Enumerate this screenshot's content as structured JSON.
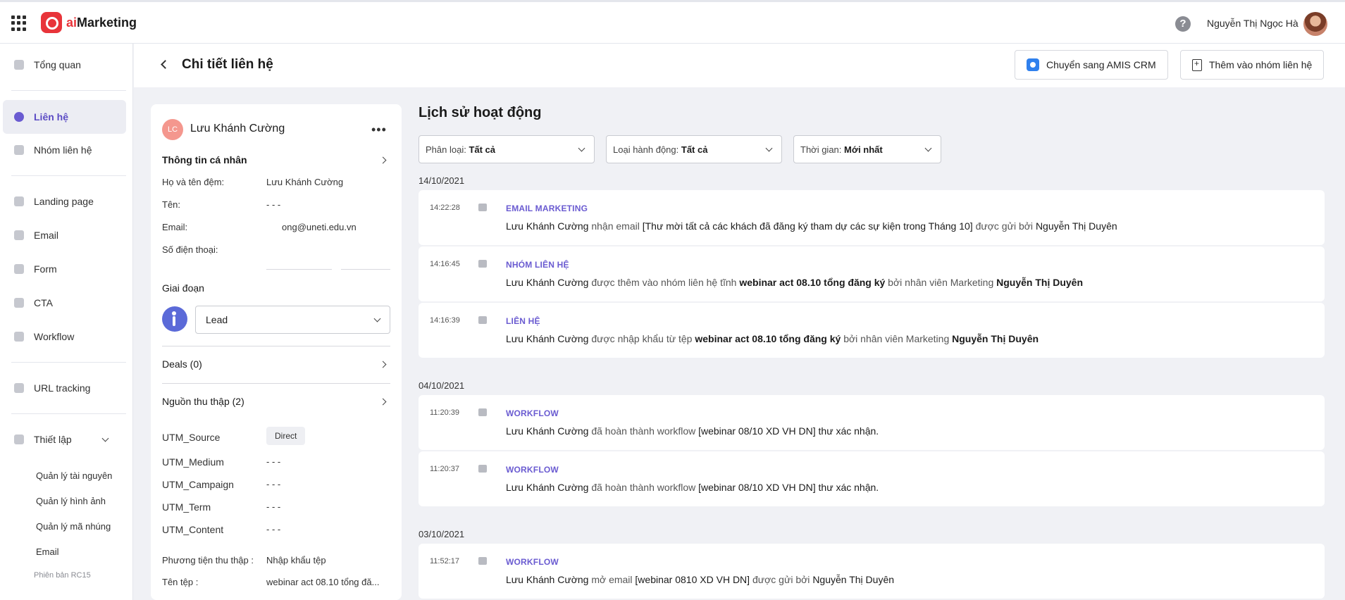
{
  "app": {
    "name_prefix": "ai",
    "name_suffix": "Marketing",
    "help_glyph": "?",
    "user_name": "Nguyễn Thị Ngọc Hà"
  },
  "sidebar": {
    "items": [
      {
        "label": "Tổng quan",
        "icon": "dashboard-icon"
      },
      {
        "label": "Liên hệ",
        "icon": "contacts-icon",
        "active": true
      },
      {
        "label": "Nhóm liên hệ",
        "icon": "contact-group-icon"
      },
      {
        "label": "Landing page",
        "icon": "landing-page-icon"
      },
      {
        "label": "Email",
        "icon": "email-icon"
      },
      {
        "label": "Form",
        "icon": "form-icon"
      },
      {
        "label": "CTA",
        "icon": "cta-icon"
      },
      {
        "label": "Workflow",
        "icon": "workflow-icon"
      },
      {
        "label": "URL tracking",
        "icon": "link-icon"
      },
      {
        "label": "Thiết lập",
        "icon": "gear-icon"
      }
    ],
    "settings_sub": [
      "Quản lý tài nguyên",
      "Quản lý hình ảnh",
      "Quản lý mã nhúng",
      "Email"
    ],
    "version": "Phiên bản RC15"
  },
  "header": {
    "title": "Chi tiết liên hệ",
    "crm_button": "Chuyển sang AMIS CRM",
    "group_button": "Thêm vào nhóm liên hệ"
  },
  "contact": {
    "initials": "LC",
    "name": "Lưu Khánh Cường",
    "more": "•••",
    "personal_title": "Thông tin cá nhân",
    "fields": [
      {
        "label": "Họ và tên đệm:",
        "value": "Lưu Khánh Cường"
      },
      {
        "label": "Tên:",
        "value": "- - -"
      },
      {
        "label": "Email:",
        "value": "ong@uneti.edu.vn"
      },
      {
        "label": "Số điện thoại:",
        "value": ""
      }
    ],
    "stage_title": "Giai đoạn",
    "stage_value": "Lead",
    "deals": "Deals (0)",
    "sources": "Nguồn thu thập (2)",
    "utm": [
      {
        "label": "UTM_Source",
        "value": "Direct"
      },
      {
        "label": "UTM_Medium",
        "value": "- - -"
      },
      {
        "label": "UTM_Campaign",
        "value": "- - -"
      },
      {
        "label": "UTM_Term",
        "value": "- - -"
      },
      {
        "label": "UTM_Content",
        "value": "- - -"
      }
    ],
    "channel_label": "Phương tiện thu thập :",
    "channel_value": "Nhập khẩu tệp",
    "file_label": "Tên tệp :",
    "file_value": "webinar act 08.10 tổng đă..."
  },
  "history": {
    "title": "Lịch sử hoạt động",
    "filters": [
      {
        "label": "Phân loại: ",
        "value": "Tất cả"
      },
      {
        "label": "Loại hành động: ",
        "value": "Tất cả"
      },
      {
        "label": "Thời gian: ",
        "value": "Mới nhất"
      }
    ],
    "groups": [
      {
        "date": "14/10/2021",
        "events": [
          {
            "time": "14:22:28",
            "type": "EMAIL MARKETING",
            "icon": "email-icon",
            "parts": [
              [
                "k",
                "Lưu Khánh Cường"
              ],
              [
                "n",
                " nhận email "
              ],
              [
                "k",
                "[Thư mời tất cả các khách đã đăng ký tham dự các sự kiện trong Tháng 10]"
              ],
              [
                "n",
                " được gửi bởi "
              ],
              [
                "k",
                "Nguyễn Thị Duyên"
              ]
            ]
          },
          {
            "time": "14:16:45",
            "type": "NHÓM LIÊN HỆ",
            "icon": "contact-group-icon",
            "parts": [
              [
                "k",
                "Lưu Khánh Cường"
              ],
              [
                "n",
                " được thêm vào nhóm liên hệ tĩnh "
              ],
              [
                "kb",
                "webinar act 08.10 tổng đăng ký"
              ],
              [
                "n",
                " bởi nhân viên Marketing "
              ],
              [
                "kb",
                "Nguyễn Thị Duyên"
              ]
            ]
          },
          {
            "time": "14:16:39",
            "type": "LIÊN HỆ",
            "icon": "contacts-icon",
            "parts": [
              [
                "k",
                "Lưu Khánh Cường"
              ],
              [
                "n",
                " được nhập khẩu từ tệp "
              ],
              [
                "kb",
                "webinar act 08.10 tổng đăng ký"
              ],
              [
                "n",
                " bởi nhân viên Marketing "
              ],
              [
                "kb",
                "Nguyễn Thị Duyên"
              ]
            ]
          }
        ]
      },
      {
        "date": "04/10/2021",
        "events": [
          {
            "time": "11:20:39",
            "type": "WORKFLOW",
            "icon": "workflow-icon",
            "parts": [
              [
                "k",
                "Lưu Khánh Cường"
              ],
              [
                "n",
                " đã hoàn thành workflow "
              ],
              [
                "k",
                "[webinar 08/10 XD VH DN]"
              ],
              [
                "k",
                " thư xác nhận."
              ]
            ]
          },
          {
            "time": "11:20:37",
            "type": "WORKFLOW",
            "icon": "workflow-icon",
            "parts": [
              [
                "k",
                "Lưu Khánh Cường"
              ],
              [
                "n",
                " đã hoàn thành workflow "
              ],
              [
                "k",
                "[webinar 08/10 XD VH DN]"
              ],
              [
                "k",
                " thư xác nhận."
              ]
            ]
          }
        ]
      },
      {
        "date": "03/10/2021",
        "events": [
          {
            "time": "11:52:17",
            "type": "WORKFLOW",
            "icon": "workflow-icon",
            "parts": [
              [
                "k",
                "Lưu Khánh Cường"
              ],
              [
                "n",
                " mở email "
              ],
              [
                "k",
                "[webinar 0810 XD VH DN]"
              ],
              [
                "n",
                " được gửi bởi "
              ],
              [
                "k",
                "Nguyễn Thị Duyên"
              ]
            ]
          }
        ]
      }
    ]
  }
}
